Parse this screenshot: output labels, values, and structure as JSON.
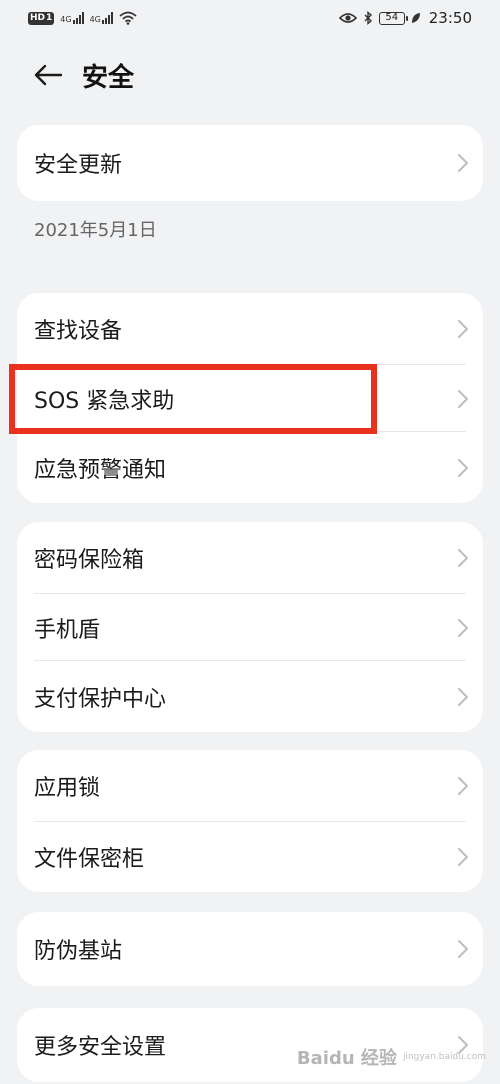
{
  "status_bar": {
    "hd_label": "HD",
    "sim_label": "1",
    "net1": "4G",
    "net2": "4G",
    "battery": "54",
    "time": "23:50"
  },
  "header": {
    "title": "安全"
  },
  "groups": [
    {
      "items": [
        {
          "label": "安全更新"
        }
      ],
      "footer": "2021年5月1日"
    },
    {
      "items": [
        {
          "label": "查找设备"
        },
        {
          "label": "SOS 紧急求助"
        },
        {
          "label": "应急预警通知"
        }
      ]
    },
    {
      "items": [
        {
          "label": "密码保险箱"
        },
        {
          "label": "手机盾"
        },
        {
          "label": "支付保护中心"
        }
      ]
    },
    {
      "items": [
        {
          "label": "应用锁"
        },
        {
          "label": "文件保密柜"
        }
      ]
    },
    {
      "items": [
        {
          "label": "防伪基站"
        }
      ]
    },
    {
      "items": [
        {
          "label": "更多安全设置"
        }
      ]
    }
  ],
  "highlight_color": "#e8321d",
  "watermark": {
    "brand": "Baidu 经验",
    "sub": "jingyan.baidu.com"
  }
}
